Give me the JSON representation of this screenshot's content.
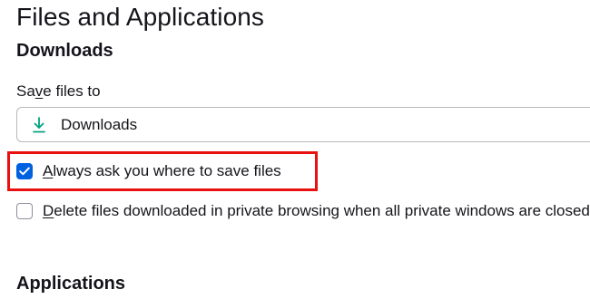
{
  "page": {
    "title": "Files and Applications"
  },
  "downloads": {
    "heading": "Downloads",
    "save_label": {
      "before": "Sa",
      "accesskey": "v",
      "after": "e files to"
    },
    "folder": {
      "icon": "download-arrow-icon",
      "name": "Downloads"
    },
    "always_ask": {
      "checked": true,
      "accesskey": "A",
      "rest": "lways ask you where to save files"
    },
    "delete_private": {
      "checked": false,
      "accesskey": "D",
      "rest": "elete files downloaded in private browsing when all private windows are closed"
    }
  },
  "applications": {
    "heading": "Applications"
  },
  "colors": {
    "accent": "#0061e0",
    "download_icon": "#00a47e",
    "highlight": "#e8110f"
  }
}
